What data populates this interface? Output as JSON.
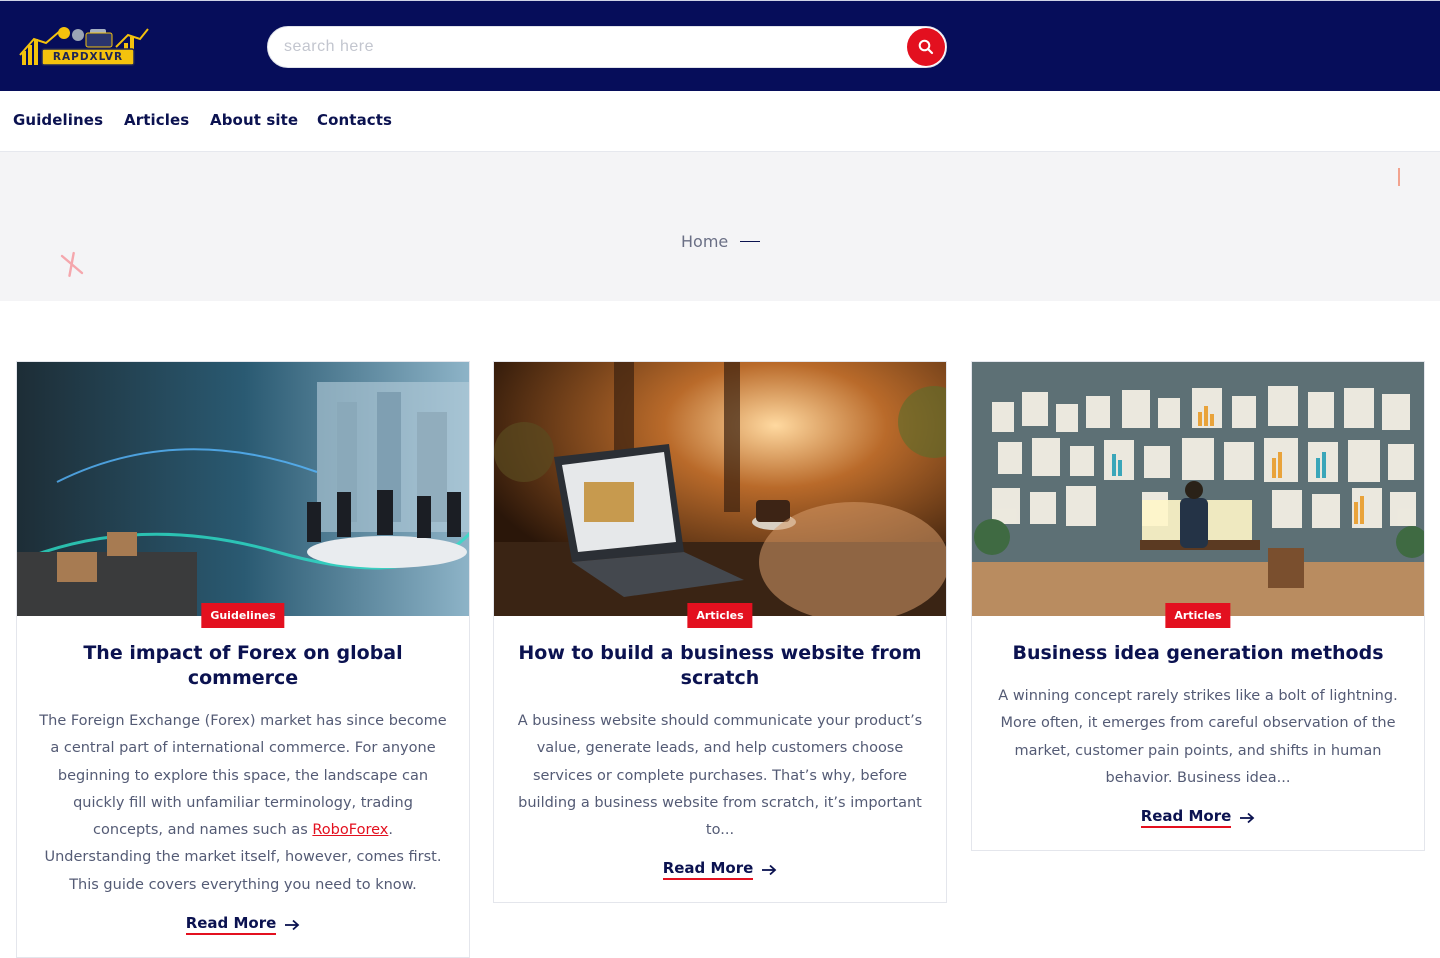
{
  "header": {
    "logo_text": "RAPDXLVR",
    "search_placeholder": "search here"
  },
  "nav": {
    "items": [
      "Guidelines",
      "Articles",
      "About site",
      "Contacts"
    ]
  },
  "breadcrumb": {
    "home": "Home"
  },
  "colors": {
    "header_bg": "#060d5a",
    "accent": "#e3101f",
    "heading": "#0b1250",
    "hero_bg": "#f4f4f6"
  },
  "cards": [
    {
      "category": "Guidelines",
      "title": "The impact of Forex on global commerce",
      "excerpt_before": "The Foreign Exchange (Forex) market has since become a central part of international commerce. For anyone beginning to explore this space, the landscape can quickly fill with unfamiliar terminology, trading concepts, and names such as ",
      "excerpt_link": "RoboForex",
      "excerpt_after": ". Understanding the market itself, however, comes first. This guide covers everything you need to know.",
      "read_more": "Read More"
    },
    {
      "category": "Articles",
      "title": "How to build a business website from scratch",
      "excerpt_before": "A business website should communicate your product’s value, generate leads, and help customers choose services or complete purchases. That’s why, before building a business website from scratch, it’s important to...",
      "excerpt_link": "",
      "excerpt_after": "",
      "read_more": "Read More"
    },
    {
      "category": "Articles",
      "title": "Business idea generation methods",
      "excerpt_before": "A winning concept rarely strikes like a bolt of lightning. More often, it emerges from careful observation of the market, customer pain points, and shifts in human behavior. Business idea...",
      "excerpt_link": "",
      "excerpt_after": "",
      "read_more": "Read More"
    }
  ]
}
